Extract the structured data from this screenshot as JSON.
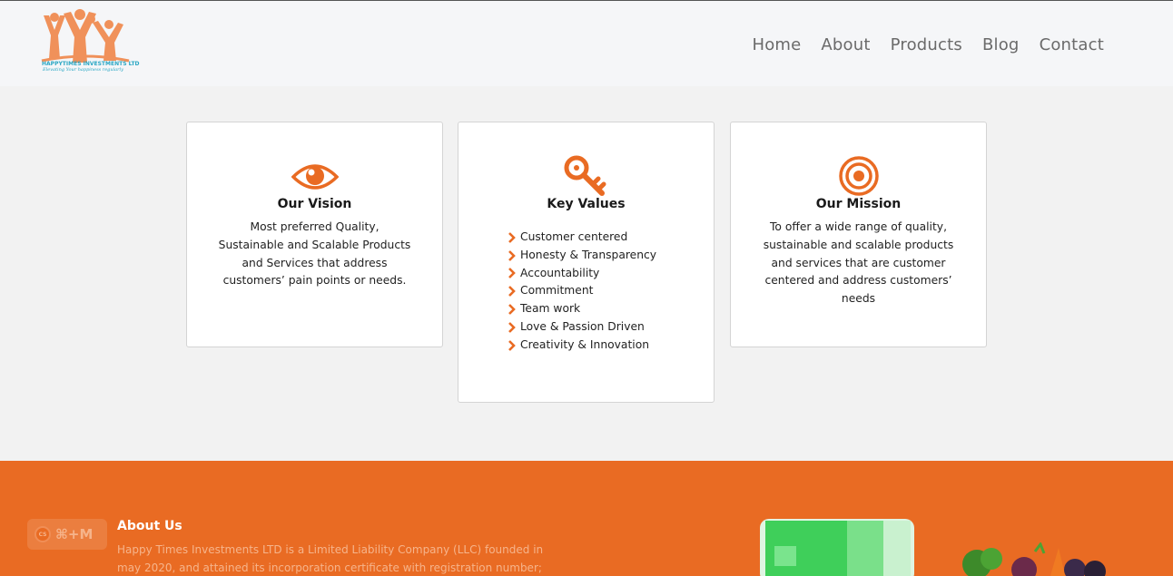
{
  "header": {
    "logo_text": "HAPPYTIMES INVESTMENTS LTD",
    "logo_tagline": "Elevating Your happiness regularly",
    "nav": [
      "Home",
      "About",
      "Products",
      "Blog",
      "Contact"
    ]
  },
  "cards": {
    "vision": {
      "title": "Our Vision",
      "text": "Most preferred Quality, Sustainable and Scalable Products and Services that address customers’ pain points or needs."
    },
    "values": {
      "title": "Key Values",
      "items": [
        "Customer centered",
        "Honesty & Transparency",
        "Accountability",
        "Commitment",
        "Team work",
        "Love & Passion Driven",
        "Creativity & Innovation"
      ]
    },
    "mission": {
      "title": "Our Mission",
      "text": "To offer a wide range of quality, sustainable and scalable products and services that are customer centered and address customers’ needs"
    }
  },
  "about": {
    "title": "About Us",
    "text": "Happy Times Investments LTD is a Limited Liability Company (LLC) founded in may 2020, and attained its incorporation certificate with registration number;"
  },
  "badge": {
    "icon_label": "CS",
    "shortcut": "⌘+M"
  },
  "colors": {
    "accent": "#e96b23",
    "header_bg": "#f5f6f8",
    "page_bg": "#f2f2f2",
    "nav_text": "#6a6a6a"
  }
}
